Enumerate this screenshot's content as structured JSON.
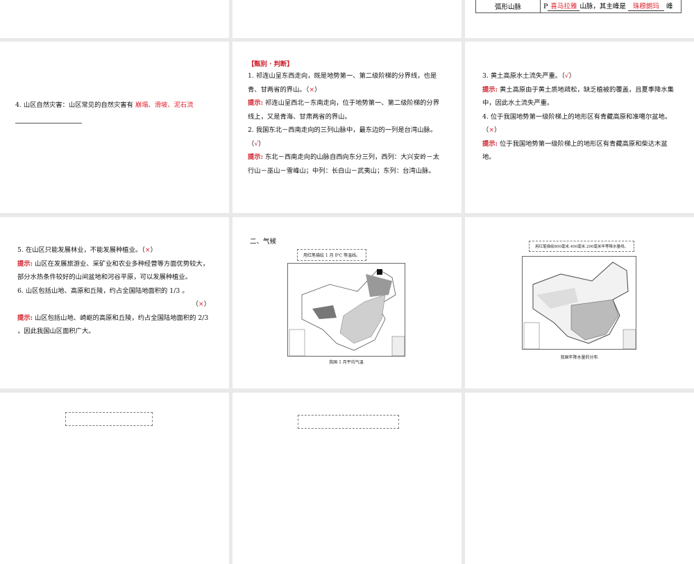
{
  "slides": {
    "s3_table": {
      "row_label": "弧形山脉",
      "prefix": "P",
      "answer1": "喜马拉雅",
      "mid": "山脉，其主峰是",
      "answer2": "珠穆朗玛",
      "suffix": "峰"
    },
    "s4": {
      "text": "4. 山区自然灾害：山区常见的自然灾害有 ",
      "answer": "崩塌、滑坡、泥石流"
    },
    "s5": {
      "heading": "【甄别 · 判断】",
      "q1": "1. 祁连山呈东西走向，既是地势第一、第二级阶梯的分界线，也是青、甘两省的界山。（",
      "q1_mark": "×",
      "q1_end": "）",
      "hint_label": "提示:",
      "h1": " 祁连山呈西北－东南走向，位于地势第一、第二级阶梯的分界线上，又是青海、甘肃两省的界山。",
      "q2": "2. 我国东北－西南走向的三列山脉中，最东边的一列是台湾山脉。（",
      "q2_mark": "√",
      "q2_end": "）",
      "h2": " 东北－西南走向的山脉自西向东分三列，西列：大兴安岭－太行山－巫山－雪峰山；中列：长白山－武夷山；东列：台湾山脉。"
    },
    "s6": {
      "q3": "3. 黄土高原水土流失严重。（",
      "q3_mark": "√",
      "q3_end": "）",
      "h3": " 黄土高原由于黄土质地疏松，缺乏植被的覆盖，且夏季降水集中，因此水土流失严重。",
      "q4": "4. 位于我国地势第一级阶梯上的地形区有青藏高原和准噶尔盆地。（",
      "q4_mark": "×",
      "q4_end": "）",
      "h4": " 位于我国地势第一级阶梯上的地形区有青藏高原和柴达木盆地。"
    },
    "s7": {
      "q5": "5. 在山区只能发展林业，不能发展种植业。（",
      "q5_mark": "×",
      "q5_end": "）",
      "h5": " 山区在发展旅游业、采矿业和农业多种经营等方面优势较大，部分水热条件较好的山间盆地和河谷平原，可以发展种植业。",
      "q6": "6. 山区包括山地、高原和丘陵，约占全国陆地面积的 1/3 。",
      "q6_mark": "×",
      "h6": " 山区包括山地、崎岖的高原和丘陵，约占全国陆地面积的 2/3 ，因此我国山区面积广大。"
    },
    "s8": {
      "heading": "二、气候",
      "callout": "用红笔描绘 1 月 0℃ 等温线。",
      "caption": "我国 1 月平均气温"
    },
    "s9": {
      "callout": "用红笔描绘800毫米.400毫米.200毫米年等降水量线。",
      "caption": "我国年降水量的分布"
    }
  }
}
